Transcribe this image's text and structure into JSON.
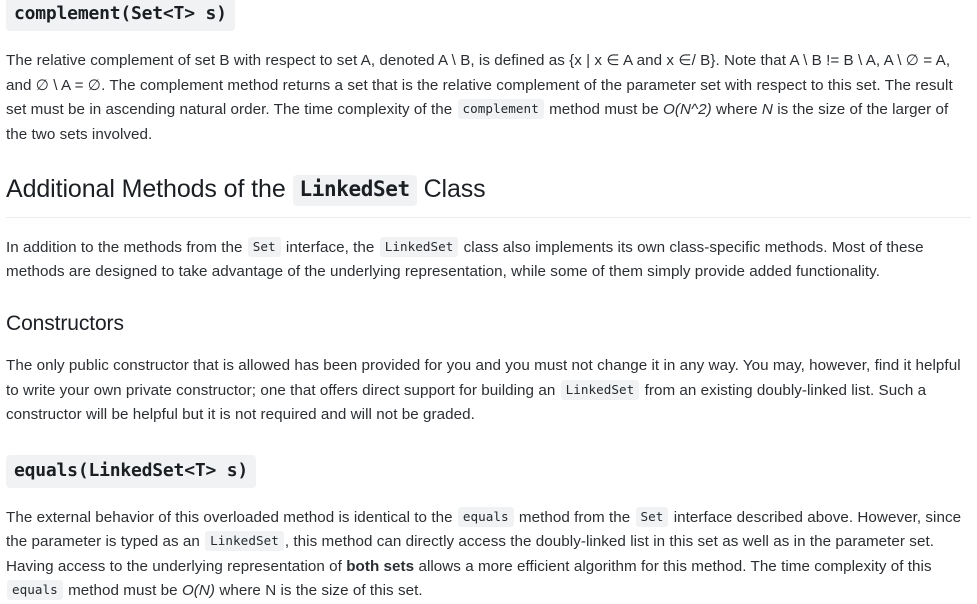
{
  "document": {
    "sections": [
      {
        "id": "complement",
        "heading_code": "complement(Set<T> s)",
        "paragraph_parts": [
          {
            "type": "text",
            "value": "The relative complement of set B with respect to set A, denoted A \\ B, is defined as {x | x ∈ A and x ∈/ B}. Note that A \\ B != B \\ A, A \\ ∅ = A, and ∅ \\ A = ∅. The complement method returns a set that is the relative complement of the parameter set with respect to this set. The result set must be in ascending natural order. The time complexity of the "
          },
          {
            "type": "code",
            "value": "complement"
          },
          {
            "type": "text",
            "value": " method must be "
          },
          {
            "type": "italic",
            "value": "O(N^2)"
          },
          {
            "type": "text",
            "value": " where "
          },
          {
            "type": "italic",
            "value": "N"
          },
          {
            "type": "text",
            "value": " is the size of the larger of the two sets involved."
          }
        ]
      },
      {
        "id": "additional-methods",
        "heading_prefix": "Additional Methods of the",
        "heading_code": "LinkedSet",
        "heading_suffix": "Class",
        "paragraph_parts": [
          {
            "type": "text",
            "value": "In addition to the methods from the "
          },
          {
            "type": "code",
            "value": "Set"
          },
          {
            "type": "text",
            "value": " interface, the "
          },
          {
            "type": "code",
            "value": "LinkedSet"
          },
          {
            "type": "text",
            "value": " class also implements its own class-specific methods. Most of these methods are designed to take advantage of the underlying representation, while some of them simply provide added functionality."
          }
        ]
      },
      {
        "id": "constructors",
        "heading": "Constructors",
        "paragraph_parts": [
          {
            "type": "text",
            "value": "The only public constructor that is allowed has been provided for you and you must not change it in any way. You may, however, find it helpful to write your own private constructor; one that offers direct support for building an "
          },
          {
            "type": "code",
            "value": "LinkedSet"
          },
          {
            "type": "text",
            "value": " from an existing doubly-linked list. Such a constructor will be helpful but it is not required and will not be graded."
          }
        ]
      },
      {
        "id": "equals",
        "heading_code": "equals(LinkedSet<T> s)",
        "paragraph_parts": [
          {
            "type": "text",
            "value": "The external behavior of this overloaded method is identical to the "
          },
          {
            "type": "code",
            "value": "equals"
          },
          {
            "type": "text",
            "value": " method from the "
          },
          {
            "type": "code",
            "value": "Set"
          },
          {
            "type": "text",
            "value": " interface described above. However, since the parameter is typed as an "
          },
          {
            "type": "code",
            "value": "LinkedSet"
          },
          {
            "type": "text",
            "value": ", this method can directly access the doubly-linked list in this set as well as in the parameter set. Having access to the underlying representation of "
          },
          {
            "type": "bold",
            "value": "both sets"
          },
          {
            "type": "text",
            "value": " allows a more efficient algorithm for this method. The time complexity of this "
          },
          {
            "type": "code",
            "value": "equals"
          },
          {
            "type": "text",
            "value": " method must be "
          },
          {
            "type": "italic",
            "value": "O(N)"
          },
          {
            "type": "text",
            "value": " where N is the size of this set."
          }
        ]
      }
    ],
    "colors": {
      "page_background": "#ffffff",
      "body_text": "#2b2f33",
      "heading_text": "#1b1f23",
      "code_chip_background": "#f1f2f3",
      "rule": "#eaecef"
    }
  }
}
